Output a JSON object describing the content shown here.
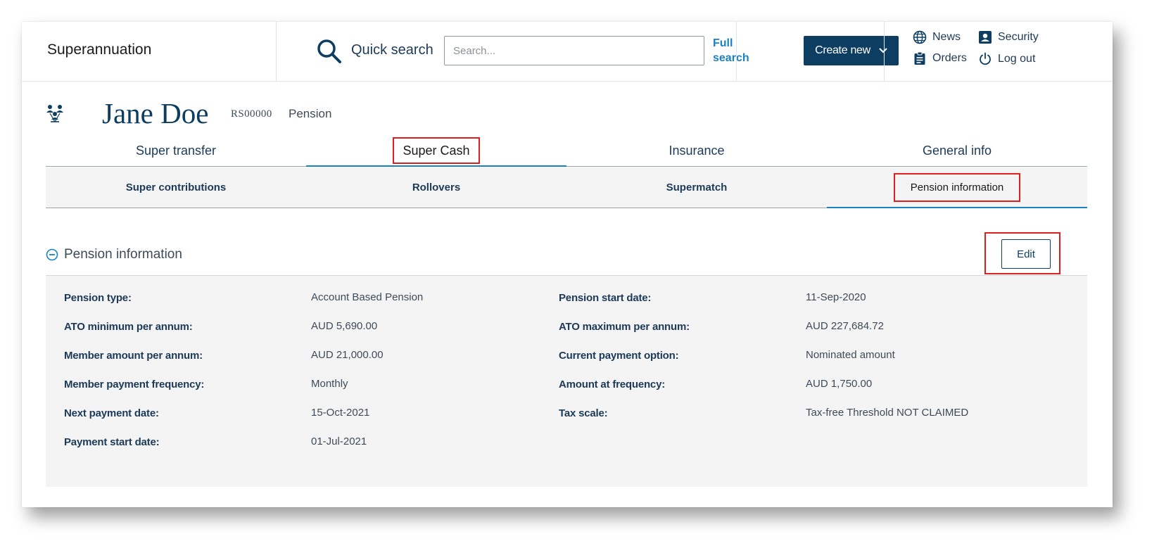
{
  "header": {
    "app_title": "Superannuation",
    "quick_search_label": "Quick search",
    "search_placeholder": "Search...",
    "full_search_label": "Full search",
    "create_new_label": "Create new",
    "links": {
      "news": "News",
      "security": "Security",
      "orders": "Orders",
      "logout": "Log out"
    }
  },
  "member": {
    "name": "Jane Doe",
    "id": "RS00000",
    "product": "Pension"
  },
  "tabs": [
    {
      "label": "Super transfer",
      "active": false
    },
    {
      "label": "Super Cash",
      "active": true
    },
    {
      "label": "Insurance",
      "active": false
    },
    {
      "label": "General info",
      "active": false
    }
  ],
  "subtabs": [
    {
      "label": "Super contributions",
      "active": false
    },
    {
      "label": "Rollovers",
      "active": false
    },
    {
      "label": "Supermatch",
      "active": false
    },
    {
      "label": "Pension information",
      "active": true
    }
  ],
  "section": {
    "title": "Pension information",
    "edit_label": "Edit",
    "fields": [
      {
        "label": "Pension type:",
        "value": "Account Based Pension"
      },
      {
        "label": "Pension start date:",
        "value": "11-Sep-2020"
      },
      {
        "label": "ATO minimum per annum:",
        "value": "AUD 5,690.00"
      },
      {
        "label": "ATO maximum per annum:",
        "value": "AUD 227,684.72"
      },
      {
        "label": "Member amount per annum:",
        "value": "AUD 21,000.00"
      },
      {
        "label": "Current payment option:",
        "value": "Nominated amount"
      },
      {
        "label": "Member payment frequency:",
        "value": "Monthly"
      },
      {
        "label": "Amount at frequency:",
        "value": "AUD 1,750.00"
      },
      {
        "label": "Next payment date:",
        "value": "15-Oct-2021"
      },
      {
        "label": "Tax scale:",
        "value": "Tax-free Threshold NOT CLAIMED"
      },
      {
        "label": "Payment start date:",
        "value": "01-Jul-2021"
      }
    ]
  },
  "colors": {
    "navy": "#0d3e62",
    "accent_blue": "#1a82c0",
    "highlight_red": "#e01e1e",
    "panel_grey": "#f4f4f4"
  }
}
